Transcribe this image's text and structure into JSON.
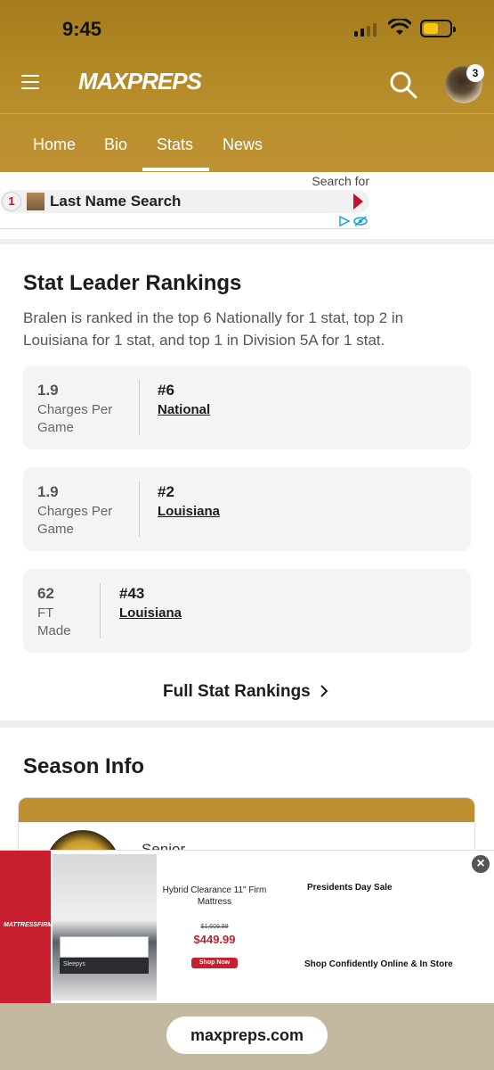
{
  "status_bar": {
    "time": "9:45"
  },
  "header": {
    "logo": "MAXPREPS",
    "avatar_badge": "3"
  },
  "tabs": [
    {
      "label": "Home"
    },
    {
      "label": "Bio"
    },
    {
      "label": "Stats",
      "active": true
    },
    {
      "label": "News"
    }
  ],
  "top_ad": {
    "search_for": "Search for",
    "number": "1",
    "title": "Last Name Search"
  },
  "stat_leader": {
    "title": "Stat Leader Rankings",
    "description": "Bralen is ranked in the top 6 Nationally for 1 stat, top 2 in Louisiana for 1 stat, and top 1 in Division 5A for 1 stat.",
    "rankings": [
      {
        "value": "1.9",
        "label": "Charges Per Game",
        "rank": "#6",
        "area": "National"
      },
      {
        "value": "1.9",
        "label": "Charges Per Game",
        "rank": "#2",
        "area": "Louisiana"
      },
      {
        "value": "62",
        "label": "FT Made",
        "rank": "#43",
        "area": "Louisiana"
      }
    ],
    "full_link": "Full Stat Rankings"
  },
  "season_info": {
    "title": "Season Info",
    "grade": "Senior"
  },
  "bottom_ad": {
    "brand": "MATTRESSFIRM",
    "product": "Hybrid Clearance 11\" Firm Mattress",
    "old_price": "$1,609.99",
    "price": "$449.99",
    "shop_button": "Shop Now",
    "promo": "Presidents Day Sale",
    "tagline": "Shop Confidently Online & In Store",
    "image_tag": "Sleepys"
  },
  "browser": {
    "url": "maxpreps.com"
  },
  "colors": {
    "header_gold": "#b78d2b",
    "accent_red": "#c8202f"
  }
}
